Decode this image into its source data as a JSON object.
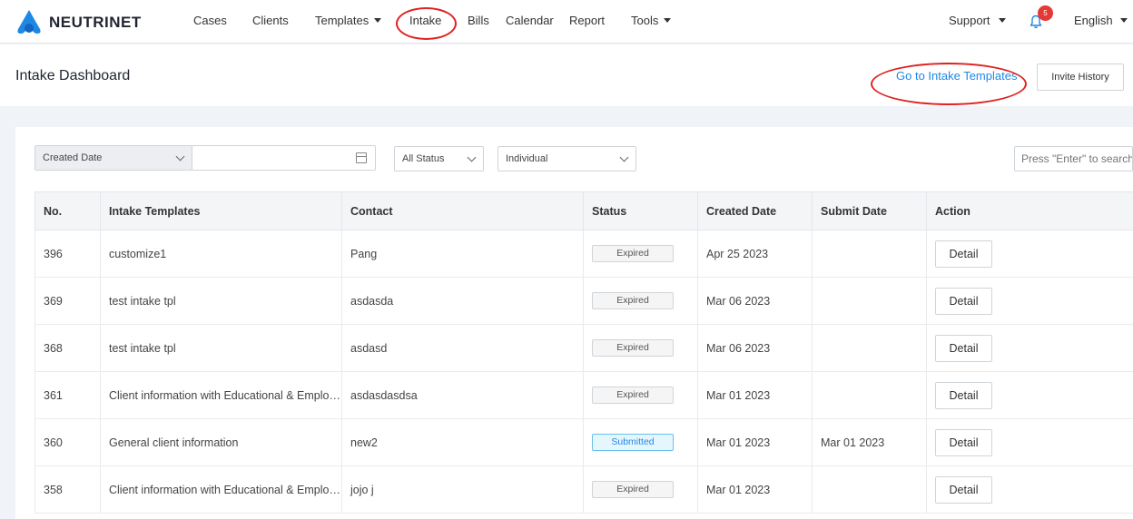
{
  "app": {
    "name": "NEUTRINET",
    "brand_color": "#1e88e5"
  },
  "nav": {
    "items": [
      "Cases",
      "Clients",
      "Templates",
      "Intake",
      "Bills",
      "Calendar",
      "Report",
      "Tools"
    ],
    "support": "Support",
    "notification_count": "5",
    "language": "English"
  },
  "header": {
    "title": "Intake Dashboard",
    "templates_link": "Go to Intake Templates",
    "history_button": "Invite History"
  },
  "filters": {
    "date_type": "Created Date",
    "date_value": "",
    "status": "All Status",
    "contact_type": "Individual",
    "search_placeholder": "Press \"Enter\" to search"
  },
  "table": {
    "columns": [
      "No.",
      "Intake Templates",
      "Contact",
      "Status",
      "Created Date",
      "Submit Date",
      "Action"
    ],
    "action_label": "Detail",
    "rows": [
      {
        "no": "396",
        "template": "customize1",
        "contact": "Pang",
        "status": "Expired",
        "created": "Apr 25 2023",
        "submitted": ""
      },
      {
        "no": "369",
        "template": "test intake tpl",
        "contact": "asdasda",
        "status": "Expired",
        "created": "Mar 06 2023",
        "submitted": ""
      },
      {
        "no": "368",
        "template": "test intake tpl",
        "contact": "asdasd",
        "status": "Expired",
        "created": "Mar 06 2023",
        "submitted": ""
      },
      {
        "no": "361",
        "template": "Client information with Educational & Employment",
        "contact": "asdasdasdsa",
        "status": "Expired",
        "created": "Mar 01 2023",
        "submitted": ""
      },
      {
        "no": "360",
        "template": "General client information",
        "contact": "new2",
        "status": "Submitted",
        "created": "Mar 01 2023",
        "submitted": "Mar 01 2023"
      },
      {
        "no": "358",
        "template": "Client information with Educational & Employment",
        "contact": "jojo j",
        "status": "Expired",
        "created": "Mar 01 2023",
        "submitted": ""
      }
    ]
  }
}
